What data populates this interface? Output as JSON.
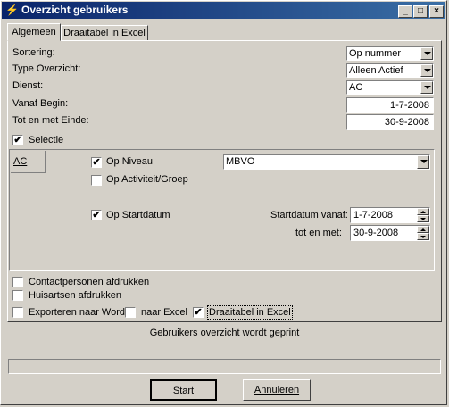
{
  "window": {
    "title": "Overzicht gebruikers",
    "controls": {
      "minimize": "_",
      "maximize": "□",
      "close": "×"
    }
  },
  "tabs": [
    "Algemeen",
    "Draaitabel in Excel"
  ],
  "form": {
    "sortering": {
      "label": "Sortering:",
      "value": "Op nummer"
    },
    "type_overzicht": {
      "label": "Type Overzicht:",
      "value": "Alleen Actief"
    },
    "dienst": {
      "label": "Dienst:",
      "value": "AC"
    },
    "vanaf_begin": {
      "label": "Vanaf Begin:",
      "value": "1-7-2008"
    },
    "tot_einde": {
      "label": "Tot en met Einde:",
      "value": "30-9-2008"
    },
    "selectie": {
      "label": "Selectie",
      "checked": true
    }
  },
  "selectie_panel": {
    "tab": "AC",
    "op_niveau": {
      "label": "Op Niveau",
      "checked": true,
      "value": "MBVO"
    },
    "op_activiteit": {
      "label": "Op Activiteit/Groep",
      "checked": false
    },
    "op_startdatum": {
      "label": "Op Startdatum",
      "checked": true
    },
    "startdatum_vanaf": {
      "label": "Startdatum vanaf:",
      "value": "1-7-2008"
    },
    "tot_en_met": {
      "label": "tot en met:",
      "value": "30-9-2008"
    }
  },
  "options": {
    "contactpersonen": {
      "label": "Contactpersonen afdrukken",
      "checked": false
    },
    "huisartsen": {
      "label": "Huisartsen afdrukken",
      "checked": false
    },
    "word": {
      "label": "Exporteren naar Word",
      "checked": false
    },
    "excel": {
      "label": "naar Excel",
      "checked": false
    },
    "draaitabel": {
      "label": "Draaitabel in Excel",
      "checked": true
    }
  },
  "status": "Gebruikers overzicht wordt geprint",
  "progress": 0,
  "buttons": {
    "start": "Start",
    "annuleren": "Annuleren"
  },
  "check_glyph": "✔"
}
